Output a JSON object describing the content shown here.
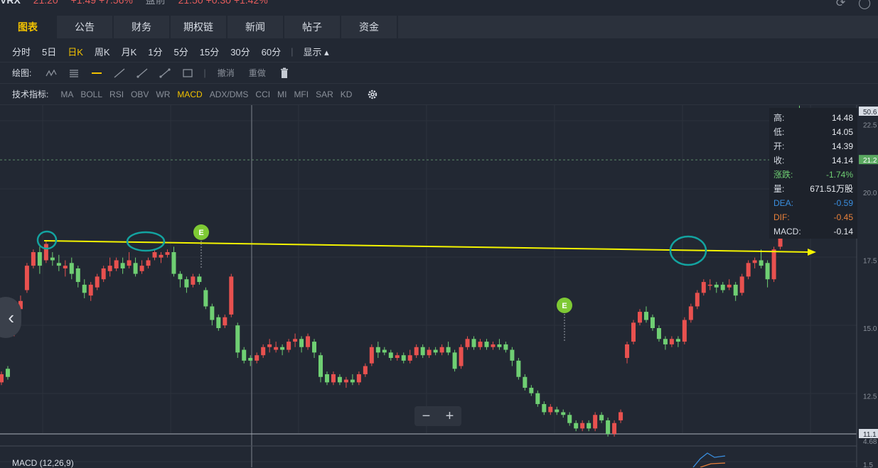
{
  "header": {
    "symbol": "VRX",
    "price": "21.20",
    "change": "+1.49 +7.56%",
    "premarket_label": "盘前",
    "premarket": "21.50 +0.30 +1.42%"
  },
  "tabs": [
    "图表",
    "公告",
    "财务",
    "期权链",
    "新闻",
    "帖子",
    "资金"
  ],
  "periods": [
    "分时",
    "5日",
    "日K",
    "周K",
    "月K",
    "1分",
    "5分",
    "15分",
    "30分",
    "60分"
  ],
  "display_label": "显示",
  "drawing": {
    "label": "绘图:",
    "undo": "撤消",
    "redo": "重做"
  },
  "indicators": {
    "label": "技术指标:",
    "items": [
      "MA",
      "BOLL",
      "RSI",
      "OBV",
      "WR",
      "MACD",
      "ADX/DMS",
      "CCI",
      "MI",
      "MFI",
      "SAR",
      "KD"
    ],
    "active": "MACD"
  },
  "info_panel": [
    {
      "k": "高:",
      "v": "14.48"
    },
    {
      "k": "低:",
      "v": "14.05"
    },
    {
      "k": "开:",
      "v": "14.39"
    },
    {
      "k": "收:",
      "v": "14.14"
    },
    {
      "k": "涨跌:",
      "v": "-1.74%"
    },
    {
      "k": "量:",
      "v": "671.51万股"
    },
    {
      "k": "DEA:",
      "v": "-0.59"
    },
    {
      "k": "DIF:",
      "v": "-0.45"
    },
    {
      "k": "MACD:",
      "v": "-0.14"
    }
  ],
  "macd_title": "MACD (12,26,9)",
  "zoom": {
    "minus": "−",
    "plus": "+"
  },
  "event_marker": "E",
  "price_axis": [
    "50.6",
    "22.5",
    "21.2",
    "20.0",
    "17.5",
    "15.0",
    "12.5",
    "11.1",
    "4.68",
    "1.5"
  ],
  "colors": {
    "up": "#e8514f",
    "down": "#6fcf73",
    "accent": "#f2c200",
    "trendline": "#f4f400",
    "circle": "#13a3a0",
    "event": "#7ec934"
  },
  "chart_data": {
    "type": "candlestick",
    "y_axis_ticks": [
      22.5,
      20.0,
      17.5,
      15.0,
      12.5
    ],
    "last_price": 21.2,
    "candles": [
      [
        13.0,
        13.3,
        12.9,
        13.4
      ],
      [
        13.5,
        13.2,
        13.1,
        13.6
      ],
      [
        14.8,
        15.6,
        14.7,
        15.7
      ],
      [
        15.7,
        16.0,
        15.6,
        16.2
      ],
      [
        16.4,
        17.3,
        16.3,
        17.4
      ],
      [
        17.3,
        17.8,
        17.2,
        17.9
      ],
      [
        17.8,
        17.3,
        17.0,
        18.0
      ],
      [
        17.5,
        18.1,
        17.4,
        18.2
      ],
      [
        17.6,
        17.5,
        17.3,
        17.8
      ],
      [
        17.4,
        17.3,
        17.1,
        17.7
      ],
      [
        17.2,
        17.3,
        16.9,
        17.5
      ],
      [
        17.4,
        17.0,
        16.8,
        17.6
      ],
      [
        17.2,
        16.7,
        16.5,
        17.3
      ],
      [
        16.6,
        16.3,
        16.1,
        16.8
      ],
      [
        16.2,
        16.6,
        16.0,
        16.7
      ],
      [
        16.5,
        16.9,
        16.4,
        17.0
      ],
      [
        16.8,
        17.2,
        16.7,
        17.3
      ],
      [
        17.1,
        17.3,
        16.9,
        17.6
      ],
      [
        17.2,
        17.5,
        17.1,
        17.6
      ],
      [
        17.4,
        17.2,
        17.0,
        17.6
      ],
      [
        17.3,
        17.5,
        17.2,
        17.8
      ],
      [
        17.4,
        17.0,
        16.9,
        17.6
      ],
      [
        17.1,
        17.3,
        17.0,
        17.5
      ],
      [
        17.3,
        17.5,
        17.2,
        17.6
      ],
      [
        17.6,
        17.8,
        17.5,
        17.9
      ],
      [
        17.6,
        17.7,
        17.4,
        17.8
      ],
      [
        17.7,
        17.8,
        17.6,
        17.9
      ],
      [
        17.8,
        17.0,
        16.9,
        18.0
      ],
      [
        17.0,
        16.8,
        16.5,
        17.1
      ],
      [
        16.8,
        16.5,
        16.3,
        16.9
      ],
      [
        16.6,
        16.9,
        16.5,
        17.0
      ],
      [
        16.9,
        16.7,
        16.6,
        17.0
      ],
      [
        16.4,
        15.8,
        15.7,
        16.5
      ],
      [
        15.8,
        15.3,
        15.1,
        15.9
      ],
      [
        15.4,
        15.0,
        14.9,
        15.5
      ],
      [
        15.1,
        15.4,
        15.0,
        15.5
      ],
      [
        15.5,
        16.9,
        15.4,
        17.0
      ],
      [
        15.1,
        14.1,
        13.9,
        15.2
      ],
      [
        14.2,
        13.8,
        13.7,
        14.3
      ],
      [
        13.9,
        13.8,
        13.6,
        14.0
      ],
      [
        13.8,
        14.0,
        13.7,
        14.1
      ],
      [
        14.0,
        14.3,
        13.9,
        14.4
      ],
      [
        14.3,
        14.4,
        14.1,
        14.6
      ],
      [
        14.2,
        14.3,
        14.1,
        14.5
      ],
      [
        14.3,
        14.2,
        14.0,
        14.4
      ],
      [
        14.2,
        14.5,
        14.1,
        14.6
      ],
      [
        14.5,
        14.6,
        14.3,
        14.8
      ],
      [
        14.6,
        14.3,
        14.1,
        14.7
      ],
      [
        14.3,
        14.7,
        14.2,
        14.8
      ],
      [
        14.5,
        14.1,
        13.9,
        14.6
      ],
      [
        14.0,
        13.2,
        13.0,
        14.1
      ],
      [
        13.3,
        13.0,
        12.9,
        13.4
      ],
      [
        13.0,
        13.3,
        12.9,
        13.4
      ],
      [
        13.2,
        13.0,
        12.9,
        13.3
      ],
      [
        13.0,
        13.1,
        12.8,
        13.2
      ],
      [
        13.1,
        13.0,
        12.9,
        13.3
      ],
      [
        13.0,
        13.3,
        12.9,
        13.4
      ],
      [
        13.3,
        13.6,
        13.2,
        13.7
      ],
      [
        13.7,
        14.3,
        13.6,
        14.4
      ],
      [
        14.3,
        14.1,
        13.9,
        14.5
      ],
      [
        14.2,
        14.1,
        14.0,
        14.3
      ],
      [
        14.1,
        13.9,
        13.8,
        14.2
      ],
      [
        13.9,
        14.0,
        13.8,
        14.1
      ],
      [
        14.0,
        13.8,
        13.7,
        14.1
      ],
      [
        13.8,
        14.0,
        13.7,
        14.2
      ],
      [
        14.0,
        14.3,
        13.9,
        14.4
      ],
      [
        14.3,
        14.0,
        13.9,
        14.4
      ],
      [
        14.0,
        14.2,
        13.9,
        14.3
      ],
      [
        14.2,
        14.1,
        14.0,
        14.3
      ],
      [
        14.1,
        14.3,
        14.0,
        14.4
      ],
      [
        14.3,
        14.1,
        14.0,
        14.5
      ],
      [
        14.1,
        13.5,
        13.4,
        14.2
      ],
      [
        13.6,
        14.3,
        13.5,
        14.4
      ],
      [
        14.3,
        14.6,
        14.2,
        14.7
      ],
      [
        14.6,
        14.3,
        14.2,
        14.7
      ],
      [
        14.3,
        14.5,
        14.2,
        14.6
      ],
      [
        14.5,
        14.3,
        14.2,
        14.6
      ],
      [
        14.3,
        14.4,
        14.2,
        14.5
      ],
      [
        14.4,
        14.3,
        14.2,
        14.6
      ],
      [
        14.4,
        14.2,
        14.1,
        14.5
      ],
      [
        14.2,
        13.8,
        13.6,
        14.3
      ],
      [
        13.8,
        13.2,
        13.1,
        13.9
      ],
      [
        13.2,
        12.8,
        12.7,
        13.3
      ],
      [
        12.8,
        12.6,
        12.5,
        12.9
      ],
      [
        12.6,
        12.2,
        12.1,
        12.7
      ],
      [
        12.2,
        11.9,
        11.8,
        12.3
      ],
      [
        11.9,
        12.1,
        11.8,
        12.2
      ],
      [
        12.0,
        11.9,
        11.8,
        12.1
      ],
      [
        11.9,
        11.8,
        11.7,
        12.0
      ],
      [
        11.8,
        11.5,
        11.4,
        11.9
      ],
      [
        11.5,
        11.3,
        11.2,
        11.6
      ],
      [
        11.3,
        11.5,
        11.2,
        11.6
      ],
      [
        11.5,
        11.3,
        11.2,
        11.6
      ],
      [
        11.3,
        11.8,
        11.2,
        11.9
      ],
      [
        11.8,
        11.6,
        11.5,
        11.9
      ],
      [
        11.6,
        11.1,
        11.0,
        11.7
      ],
      [
        11.1,
        11.5,
        11.0,
        11.6
      ],
      [
        11.6,
        11.9,
        11.5,
        12.0
      ],
      [
        13.9,
        14.4,
        13.7,
        14.5
      ],
      [
        14.5,
        15.2,
        14.4,
        15.3
      ],
      [
        15.2,
        15.6,
        15.1,
        15.7
      ],
      [
        15.6,
        15.3,
        15.2,
        15.8
      ],
      [
        15.4,
        15.0,
        14.9,
        15.5
      ],
      [
        15.0,
        14.6,
        14.5,
        15.1
      ],
      [
        14.6,
        14.4,
        14.2,
        14.7
      ],
      [
        14.4,
        14.6,
        14.3,
        14.7
      ],
      [
        14.6,
        14.5,
        14.3,
        14.7
      ],
      [
        14.5,
        15.3,
        14.4,
        15.4
      ],
      [
        15.3,
        15.8,
        15.2,
        15.9
      ],
      [
        15.8,
        16.3,
        15.7,
        16.4
      ],
      [
        16.3,
        16.7,
        16.2,
        16.8
      ],
      [
        16.6,
        16.6,
        16.4,
        16.8
      ],
      [
        16.6,
        16.5,
        16.3,
        16.7
      ],
      [
        16.6,
        16.4,
        16.3,
        16.7
      ],
      [
        16.5,
        16.6,
        16.4,
        16.8
      ],
      [
        16.6,
        16.2,
        16.0,
        16.7
      ],
      [
        16.3,
        16.9,
        16.2,
        17.0
      ],
      [
        16.9,
        17.4,
        16.8,
        17.5
      ],
      [
        17.4,
        17.5,
        17.2,
        17.6
      ],
      [
        17.5,
        17.3,
        17.2,
        17.9
      ],
      [
        17.4,
        16.8,
        16.5,
        17.5
      ],
      [
        16.8,
        17.9,
        16.7,
        18.0
      ],
      [
        18.0,
        19.9,
        17.9,
        20.1
      ],
      [
        19.8,
        21.0,
        19.7,
        21.3
      ],
      [
        21.0,
        22.8,
        20.9,
        23.1
      ],
      [
        22.8,
        20.6,
        20.5,
        23.2
      ],
      [
        21.0,
        19.5,
        19.0,
        22.0
      ],
      [
        19.8,
        20.3,
        19.3,
        20.8
      ],
      [
        20.4,
        21.2,
        20.2,
        21.7
      ]
    ]
  }
}
